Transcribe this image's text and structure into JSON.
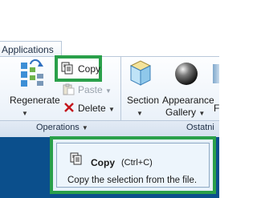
{
  "ribbon": {
    "tab_label": "Applications",
    "buttons": {
      "regenerate": "Regenerate",
      "copy": "Copy",
      "paste": "Paste",
      "delete": "Delete",
      "section": "Section",
      "appearance_line1": "Appearance",
      "appearance_line2": "Gallery"
    },
    "groups": {
      "operations": "Operations",
      "ostatni": "Ostatni"
    }
  },
  "tooltip": {
    "title": "Copy",
    "shortcut": "(Ctrl+C)",
    "description": "Copy the selection from the file."
  },
  "colors": {
    "highlight": "#2aa04a",
    "band": "#0b4f8c"
  }
}
